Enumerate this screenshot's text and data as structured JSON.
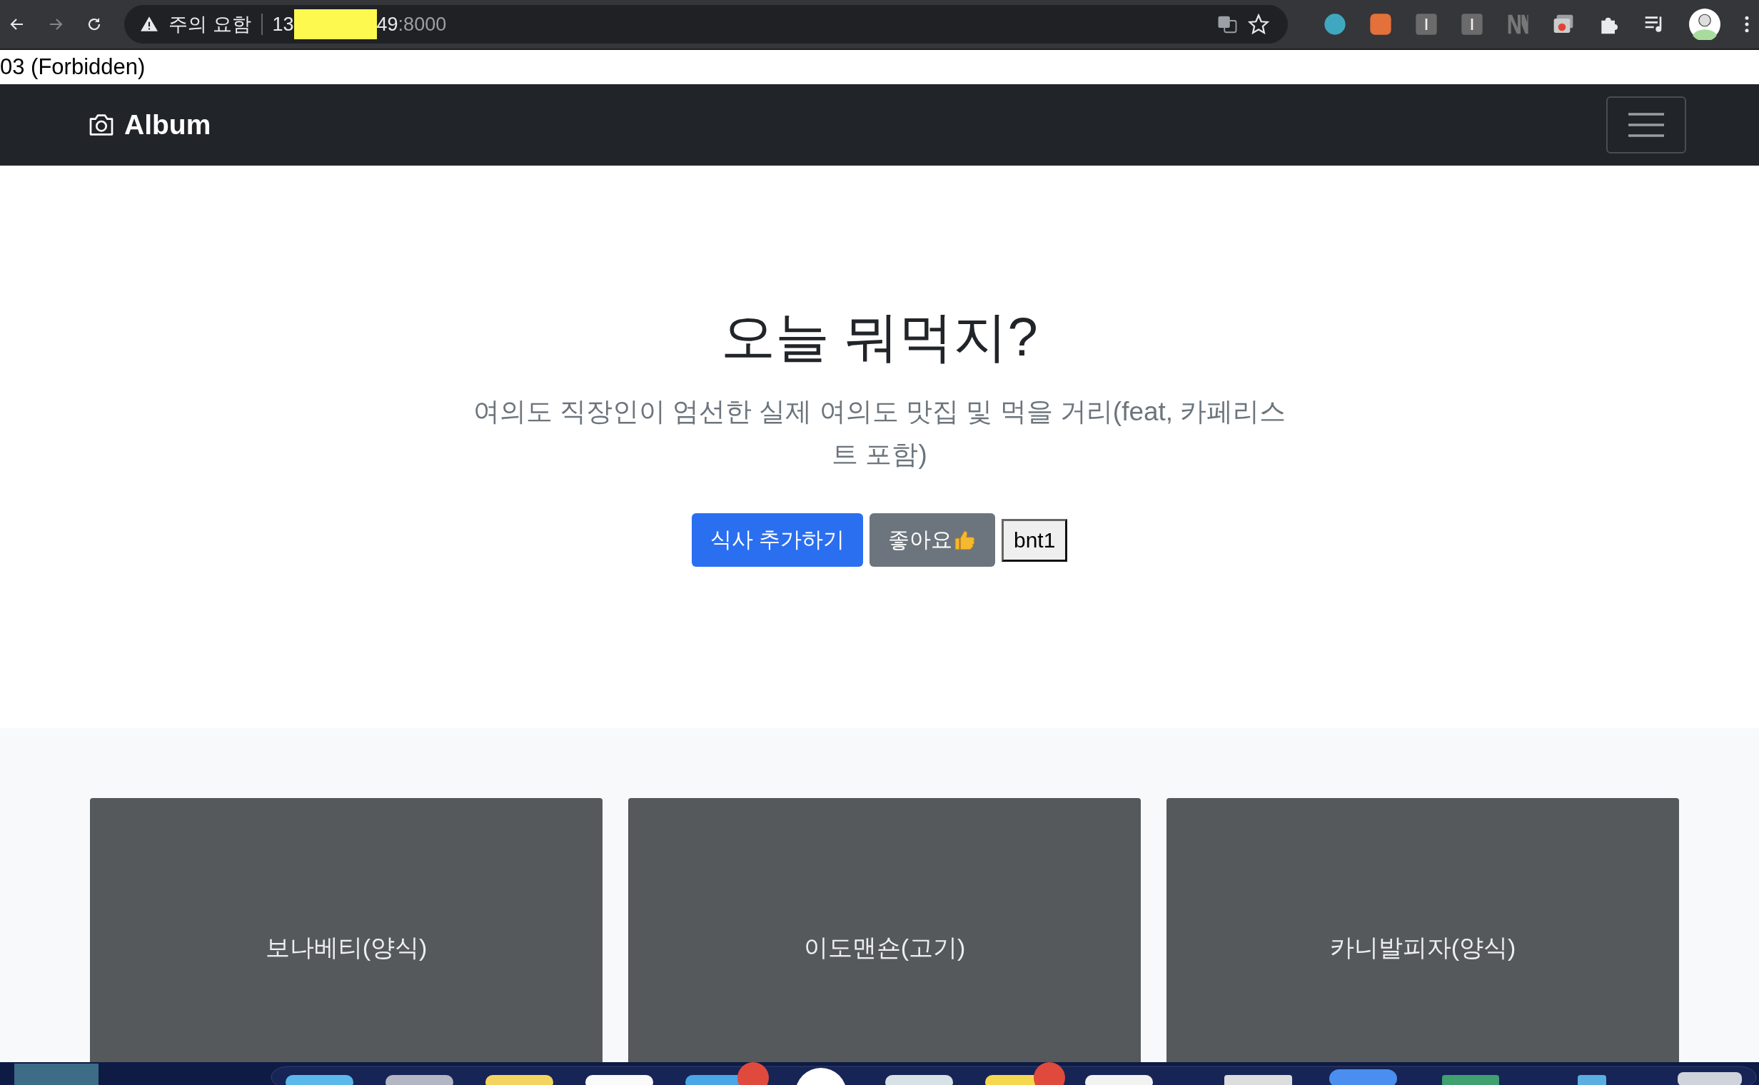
{
  "browser": {
    "security_label": "주의 요함",
    "url_start": "13",
    "url_end": "49",
    "url_port": ":8000",
    "redacted": true
  },
  "status_line": "03 (Forbidden)",
  "navbar": {
    "brand": "Album"
  },
  "hero": {
    "title": "오늘 뭐먹지?",
    "lead": "여의도 직장인이 엄선한 실제 여의도 맛집 및 먹을 거리(feat, 카페리스트 포함)",
    "buttons": [
      {
        "label": "식사 추가하기",
        "kind": "primary"
      },
      {
        "label": "좋아요",
        "kind": "secondary"
      },
      {
        "label": "bnt1",
        "kind": "plain"
      }
    ]
  },
  "cards": [
    {
      "title": "보나베티(양식)"
    },
    {
      "title": "이도맨숀(고기)"
    },
    {
      "title": "카니발피자(양식)"
    }
  ]
}
